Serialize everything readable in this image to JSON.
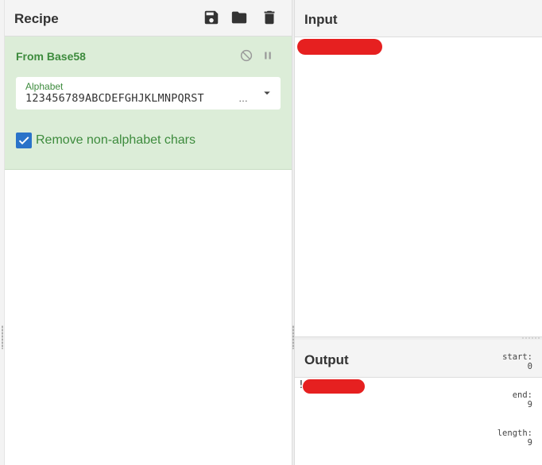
{
  "recipe": {
    "title": "Recipe",
    "icons": [
      "save-icon",
      "folder-icon",
      "trash-icon"
    ],
    "operation": {
      "name": "From Base58",
      "controls": [
        "disable-icon",
        "pause-icon"
      ],
      "alphabet": {
        "label": "Alphabet",
        "value": "123456789ABCDEFGHJKLMNPQRST",
        "truncation": "…"
      },
      "remove_non_alphabet": {
        "label": "Remove non-alphabet chars",
        "checked": true
      }
    },
    "colors": {
      "operation_bg": "#dcedd8",
      "operation_text": "#3d8b3d",
      "checkbox": "#2a73c9"
    }
  },
  "input": {
    "title": "Input"
  },
  "output": {
    "title": "Output",
    "prefix": "!",
    "stats": {
      "start_label": "start:",
      "start_value": "0",
      "end_label": "end:",
      "end_value": "9",
      "length_label": "length:",
      "length_value": "9"
    }
  },
  "redaction_color": "#e62020"
}
